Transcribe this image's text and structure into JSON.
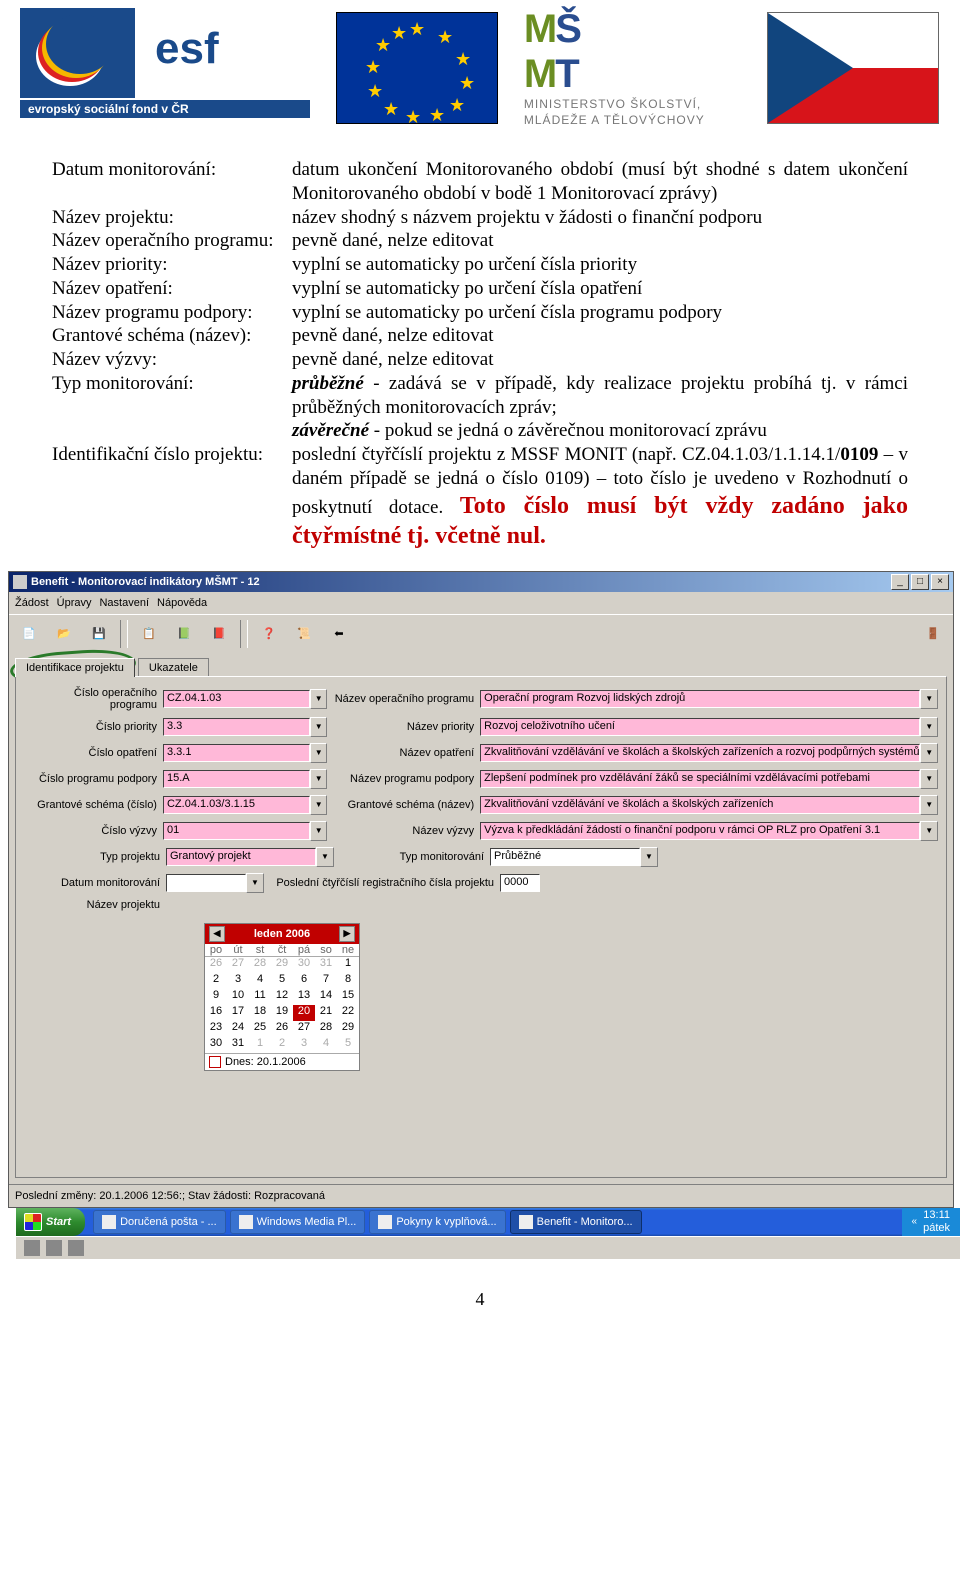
{
  "logos": {
    "esf_l1": "esf",
    "esf_l2": "evropský sociální fond v ČR",
    "msmt_big_1": "M",
    "msmt_big_2": "Š",
    "msmt_big_3": "M",
    "msmt_big_4": "T",
    "msmt_l1": "MINISTERSTVO ŠKOLSTVÍ,",
    "msmt_l2": "MLÁDEŽE A TĚLOVÝCHOVY"
  },
  "definitions": [
    {
      "term": "Datum monitorování:",
      "desc_html": "datum ukončení Monitorovaného období (musí být shodné s datem ukončení Monitorovaného období v bodě 1 Monitorovací zprávy)"
    },
    {
      "term": "Název projektu:",
      "desc_html": "název shodný s názvem projektu v žádosti o finanční podporu"
    },
    {
      "term": "Název operačního programu:",
      "desc_html": "pevně dané, nelze editovat"
    },
    {
      "term": "Název priority:",
      "desc_html": "vyplní se automaticky po určení čísla priority"
    },
    {
      "term": "Název opatření:",
      "desc_html": "vyplní se automaticky po určení čísla opatření"
    },
    {
      "term": "Název programu podpory:",
      "desc_html": "vyplní se automaticky po určení čísla programu podpory"
    },
    {
      "term": "Grantové schéma (název):",
      "desc_html": "pevně dané, nelze editovat"
    },
    {
      "term": "Název výzvy:",
      "desc_html": "pevně dané, nelze editovat"
    },
    {
      "term": "Typ monitorování:",
      "desc_html": "<span class=\"bi\">průběžné</span> - zadává se v případě, kdy realizace projektu probíhá tj. v rámci průběžných monitorovacích zpráv;<br><span class=\"bi\">závěrečné</span> - pokud se jedná o závěrečnou monitorovací zprávu"
    },
    {
      "term": "Identifikační číslo projektu:",
      "desc_html": "poslední čtyřčíslí projektu z MSSF MONIT (např. CZ.04.1.03/1.1.14.1/<span class=\"b\">0109</span> – v daném případě se jedná o číslo 0109) – toto číslo je uvedeno v Rozhodnutí o poskytnutí dotace. <span class=\"red\">Toto číslo musí být vždy zadáno jako čtyřmístné tj. včetně nul.</span>"
    }
  ],
  "page_number": "4",
  "win": {
    "title": "Benefit - Monitorovací indikátory MŠMT - 12",
    "menu": [
      "Žádost",
      "Úpravy",
      "Nastavení",
      "Nápověda"
    ],
    "tabs": {
      "active": "Identifikace projektu",
      "other": "Ukazatele"
    },
    "fields": {
      "cislo_op_l": "Číslo operačního programu",
      "cislo_op_v": "CZ.04.1.03",
      "nazev_op_l": "Název operačního programu",
      "nazev_op_v": "Operační program Rozvoj lidských zdrojů",
      "cislo_pr_l": "Číslo priority",
      "cislo_pr_v": "3.3",
      "nazev_pr_l": "Název priority",
      "nazev_pr_v": "Rozvoj celoživotního učení",
      "cislo_opat_l": "Číslo opatření",
      "cislo_opat_v": "3.3.1",
      "nazev_opat_l": "Název opatření",
      "nazev_opat_v": "Zkvalitňování vzdělávání ve školách a školských zařízeních a rozvoj podpůrných systémů vzdělávání",
      "cislo_pp_l": "Číslo programu podpory",
      "cislo_pp_v": "15.A",
      "nazev_pp_l": "Název programu podpory",
      "nazev_pp_v": "Zlepšení podmínek pro vzdělávání žáků se speciálními vzdělávacími potřebami",
      "gs_cislo_l": "Grantové schéma (číslo)",
      "gs_cislo_v": "CZ.04.1.03/3.1.15",
      "gs_nazev_l": "Grantové schéma (název)",
      "gs_nazev_v": "Zkvalitňování vzdělávání ve školách a školských zařízeních",
      "cislo_vyz_l": "Číslo výzvy",
      "cislo_vyz_v": "01",
      "nazev_vyz_l": "Název výzvy",
      "nazev_vyz_v": "Výzva k předkládání žádostí o finanční podporu v rámci OP RLZ pro Opatření 3.1",
      "typ_proj_l": "Typ projektu",
      "typ_proj_v": "Grantový projekt",
      "typ_mon_l": "Typ monitorování",
      "typ_mon_v": "Průběžné",
      "datum_mon_l": "Datum monitorování",
      "datum_mon_v": "",
      "reg_l": "Poslední čtyřčíslí registračního čísla projektu",
      "reg_v": "0000",
      "nazev_proj_l": "Název projektu"
    },
    "status": "Poslední změny: 20.1.2006 12:56:; Stav žádosti: Rozpracovaná"
  },
  "datepicker": {
    "month": "leden 2006",
    "dow": [
      "po",
      "út",
      "st",
      "čt",
      "pá",
      "so",
      "ne"
    ],
    "cells": [
      {
        "v": "26",
        "dim": true
      },
      {
        "v": "27",
        "dim": true
      },
      {
        "v": "28",
        "dim": true
      },
      {
        "v": "29",
        "dim": true
      },
      {
        "v": "30",
        "dim": true
      },
      {
        "v": "31",
        "dim": true
      },
      {
        "v": "1"
      },
      {
        "v": "2"
      },
      {
        "v": "3"
      },
      {
        "v": "4"
      },
      {
        "v": "5"
      },
      {
        "v": "6"
      },
      {
        "v": "7"
      },
      {
        "v": "8"
      },
      {
        "v": "9"
      },
      {
        "v": "10"
      },
      {
        "v": "11"
      },
      {
        "v": "12"
      },
      {
        "v": "13"
      },
      {
        "v": "14"
      },
      {
        "v": "15"
      },
      {
        "v": "16"
      },
      {
        "v": "17"
      },
      {
        "v": "18"
      },
      {
        "v": "19"
      },
      {
        "v": "20",
        "today": true
      },
      {
        "v": "21"
      },
      {
        "v": "22"
      },
      {
        "v": "23"
      },
      {
        "v": "24"
      },
      {
        "v": "25"
      },
      {
        "v": "26"
      },
      {
        "v": "27"
      },
      {
        "v": "28"
      },
      {
        "v": "29"
      },
      {
        "v": "30"
      },
      {
        "v": "31"
      },
      {
        "v": "1",
        "dim": true
      },
      {
        "v": "2",
        "dim": true
      },
      {
        "v": "3",
        "dim": true
      },
      {
        "v": "4",
        "dim": true
      },
      {
        "v": "5",
        "dim": true
      }
    ],
    "today": "Dnes: 20.1.2006"
  },
  "taskbar": {
    "start": "Start",
    "items": [
      {
        "label": "Doručená pošta - ..."
      },
      {
        "label": "Windows Media Pl..."
      },
      {
        "label": "Pokyny k vyplňová..."
      },
      {
        "label": "Benefit - Monitoro...",
        "active": true
      }
    ],
    "clock_time": "13:11",
    "clock_day": "pátek"
  }
}
